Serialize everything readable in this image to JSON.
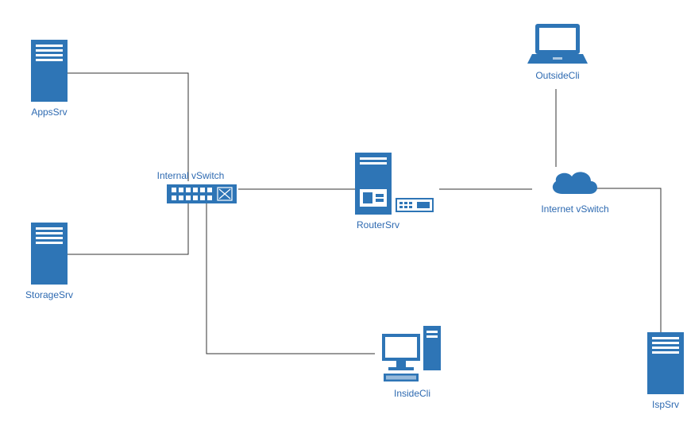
{
  "nodes": {
    "apps_srv": {
      "label": "AppsSrv"
    },
    "storage_srv": {
      "label": "StorageSrv"
    },
    "internal_vswitch": {
      "label": "Internal vSwitch"
    },
    "router_srv": {
      "label": "RouterSrv"
    },
    "inside_cli": {
      "label": "InsideCli"
    },
    "outside_cli": {
      "label": "OutsideCli"
    },
    "internet_vswitch": {
      "label": "Internet vSwitch"
    },
    "isp_srv": {
      "label": "IspSrv"
    }
  },
  "colors": {
    "primary": "#2e75b6",
    "text": "#2e6ab1"
  }
}
